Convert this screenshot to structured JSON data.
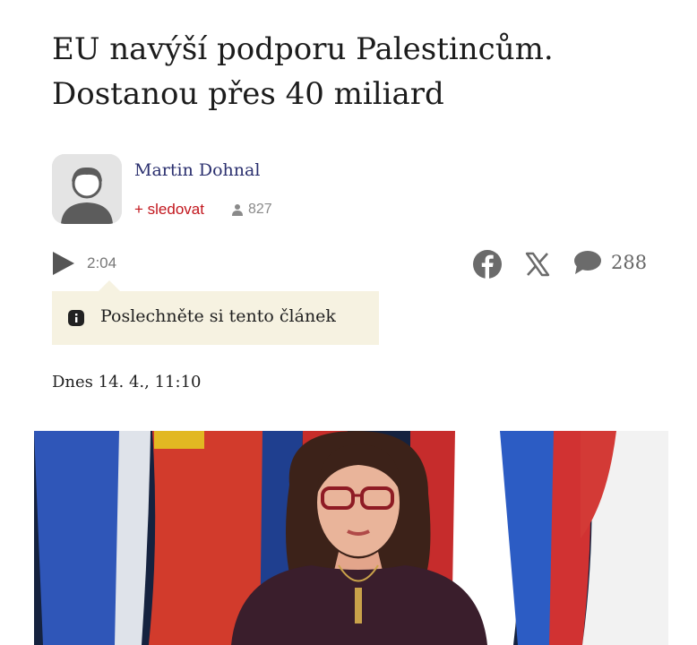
{
  "article": {
    "headline_line1": "EU navýší podporu Palestincům.",
    "headline_line2": "Dostanou přes 40 miliard",
    "date": "Dnes 14. 4., 11:10"
  },
  "author": {
    "name": "Martin Dohnal",
    "follow_label": "+ sledovat",
    "followers_count": "827",
    "avatar_icon": "user-silhouette-icon"
  },
  "audio": {
    "play_icon": "play-icon",
    "duration": "2:04",
    "tooltip": "Poslechněte si tento článek"
  },
  "share": {
    "facebook_icon": "facebook-icon",
    "x_icon": "x-icon",
    "comment_icon": "comment-icon",
    "comments_count": "288"
  },
  "colors": {
    "author": "#2a2f6e",
    "follow": "#c2161d",
    "tooltip_bg": "#f6f2e1"
  }
}
